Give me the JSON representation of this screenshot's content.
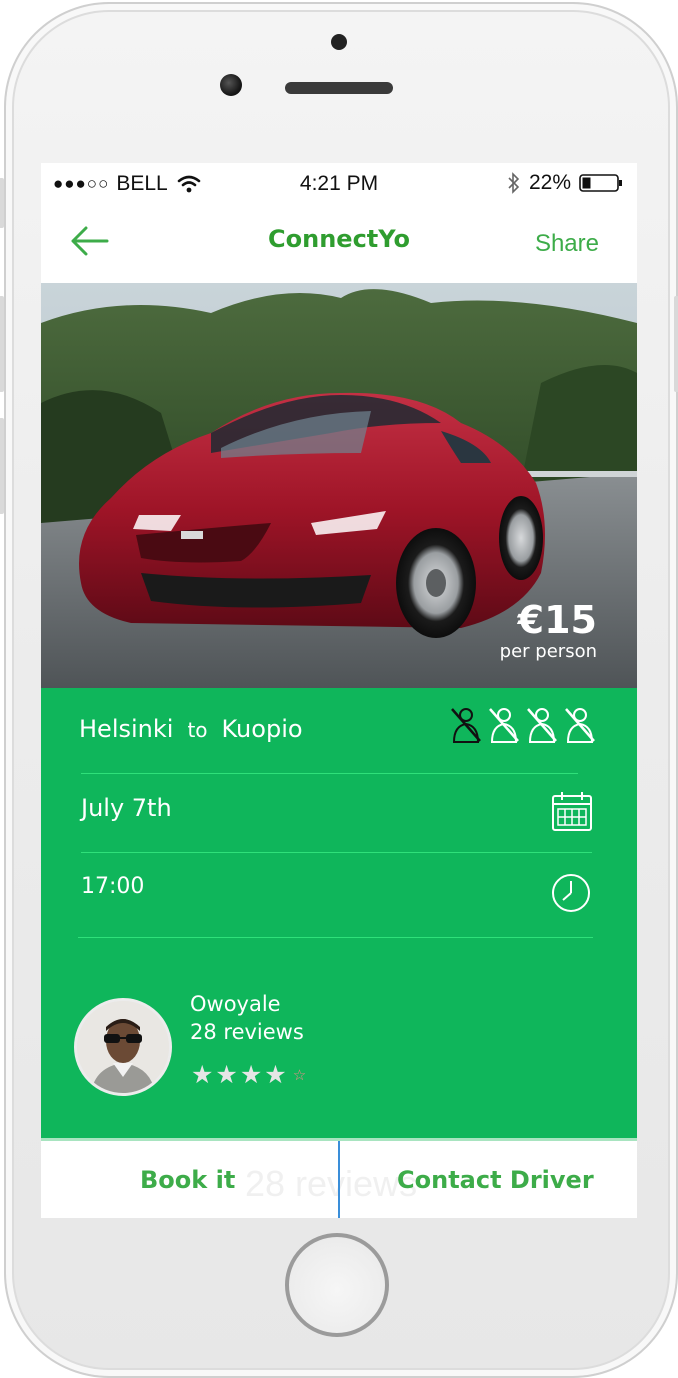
{
  "status_bar": {
    "signal": "●●●○○",
    "carrier": "BELL",
    "time": "4:21 PM",
    "battery": "22%"
  },
  "nav": {
    "title": "ConnectYo",
    "share_label": "Share"
  },
  "ride": {
    "price": "€15",
    "price_unit": "per person",
    "from": "Helsinki",
    "to_word": "to",
    "to": "Kuopio",
    "seats_total": 4,
    "seats_taken": 1,
    "date": "July 7th",
    "time": "17:00"
  },
  "driver": {
    "name": "Owoyale",
    "reviews": "28 reviews",
    "rating": 4.5
  },
  "actions": {
    "book_label": "Book it",
    "contact_label": "Contact Driver",
    "ghost_text": "28 reviews"
  },
  "colors": {
    "accent_green": "#0fb65b",
    "text_green": "#3dac49",
    "title_green": "#2f9d2f"
  }
}
